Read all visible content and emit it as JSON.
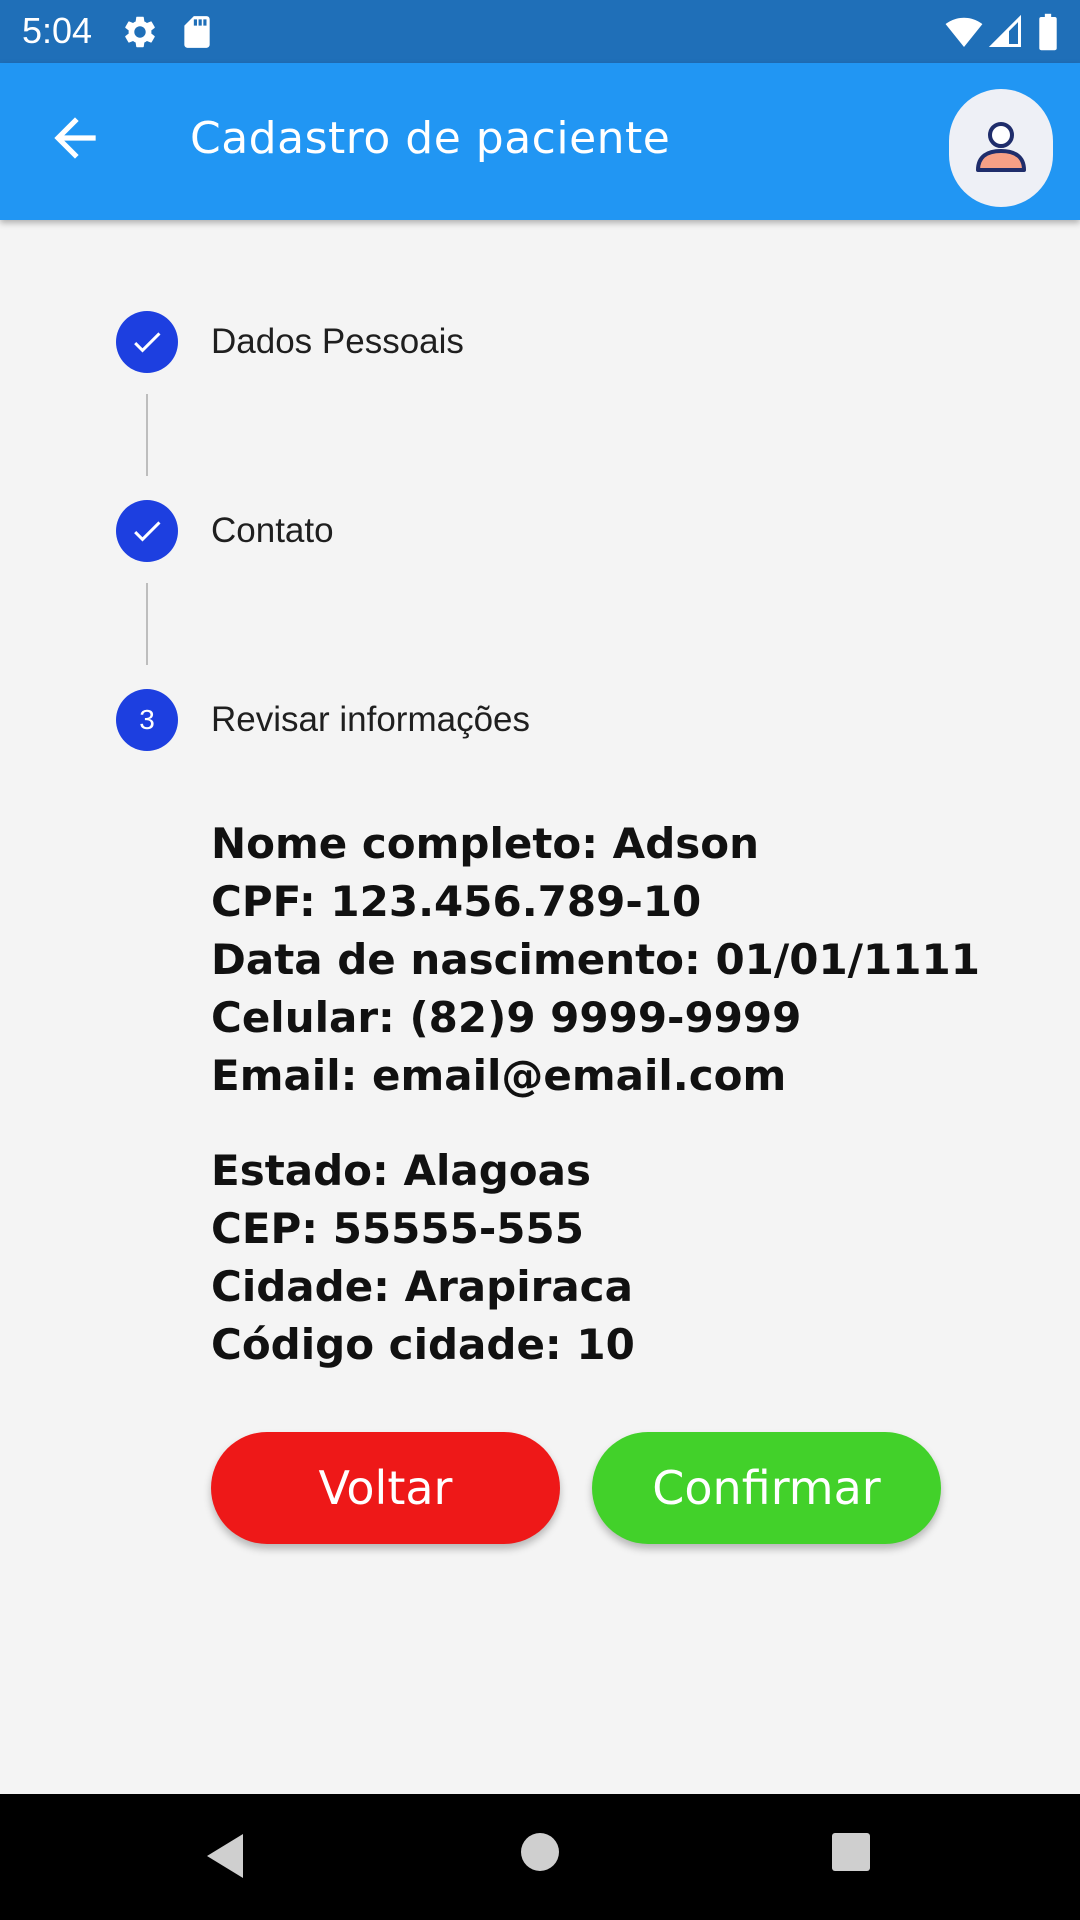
{
  "status_bar": {
    "time": "5:04",
    "icons": [
      "gear-icon",
      "sd-card-icon",
      "wifi-icon",
      "signal-icon",
      "battery-icon"
    ]
  },
  "app_bar": {
    "title": "Cadastro de paciente",
    "back_icon": "arrow-back-icon",
    "avatar_icon": "person-icon"
  },
  "stepper": {
    "steps": [
      {
        "label": "Dados Pessoais",
        "status": "completed"
      },
      {
        "label": "Contato",
        "status": "completed"
      },
      {
        "label": "Revisar informações",
        "status": "active",
        "number": "3"
      }
    ]
  },
  "review": {
    "personal": [
      "Nome completo: Adson",
      "CPF: 123.456.789-10",
      "Data de nascimento: 01/01/1111",
      "Celular: (82)9 9999-9999",
      "Email: email@email.com"
    ],
    "address": [
      "Estado: Alagoas",
      "CEP: 55555-555",
      "Cidade: Arapiraca",
      "Código cidade: 10"
    ]
  },
  "actions": {
    "back_label": "Voltar",
    "confirm_label": "Confirmar"
  },
  "colors": {
    "status_bar": "#1f6fb8",
    "app_bar": "#2196f3",
    "step_circle": "#1d3fe0",
    "back_button": "#ee1818",
    "confirm_button": "#42d12a",
    "avatar_skin": "#f7a086",
    "avatar_outline": "#1f2d6b"
  },
  "nav_bar": {
    "icons": [
      "back-triangle-icon",
      "home-circle-icon",
      "recents-square-icon"
    ]
  }
}
